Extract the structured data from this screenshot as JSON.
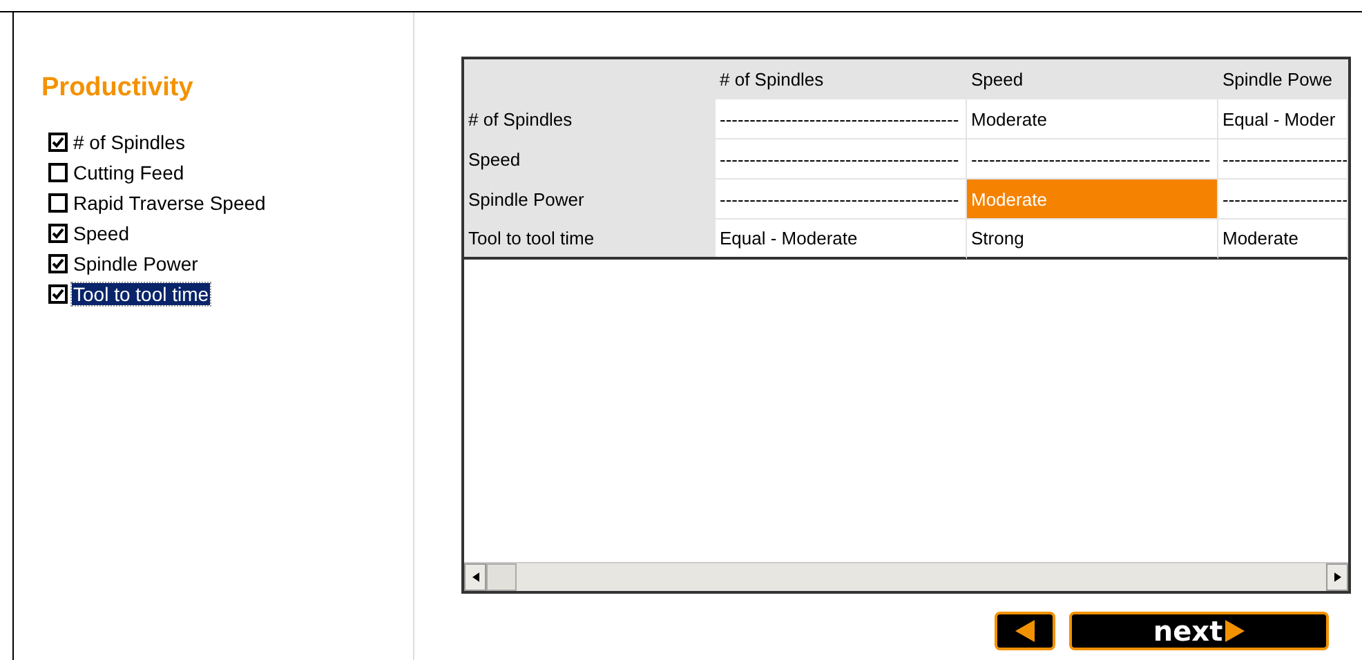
{
  "title": "Productivity",
  "criteria": [
    {
      "label": "# of Spindles",
      "checked": true,
      "selected": false
    },
    {
      "label": "Cutting Feed",
      "checked": false,
      "selected": false
    },
    {
      "label": "Rapid Traverse Speed",
      "checked": false,
      "selected": false
    },
    {
      "label": "Speed",
      "checked": true,
      "selected": false
    },
    {
      "label": "Spindle Power",
      "checked": true,
      "selected": false
    },
    {
      "label": "Tool to tool time",
      "checked": true,
      "selected": true
    }
  ],
  "table": {
    "columns": [
      "# of Spindles",
      "Speed",
      "Spindle Powe"
    ],
    "rows": [
      {
        "header": "# of Spindles",
        "cells": [
          {
            "text": "----------------------------------------",
            "highlighted": false
          },
          {
            "text": "Moderate",
            "highlighted": false
          },
          {
            "text": "Equal - Moder",
            "highlighted": false
          }
        ]
      },
      {
        "header": "Speed",
        "cells": [
          {
            "text": "----------------------------------------",
            "highlighted": false
          },
          {
            "text": "----------------------------------------",
            "highlighted": false
          },
          {
            "text": "---------------------",
            "highlighted": false
          }
        ]
      },
      {
        "header": "Spindle Power",
        "cells": [
          {
            "text": "----------------------------------------",
            "highlighted": false
          },
          {
            "text": "Moderate",
            "highlighted": true
          },
          {
            "text": "---------------------",
            "highlighted": false
          }
        ]
      },
      {
        "header": "Tool to tool time",
        "cells": [
          {
            "text": "Equal - Moderate",
            "highlighted": false
          },
          {
            "text": "Strong",
            "highlighted": false
          },
          {
            "text": "Moderate",
            "highlighted": false
          }
        ]
      }
    ]
  },
  "buttons": {
    "next": "next"
  }
}
